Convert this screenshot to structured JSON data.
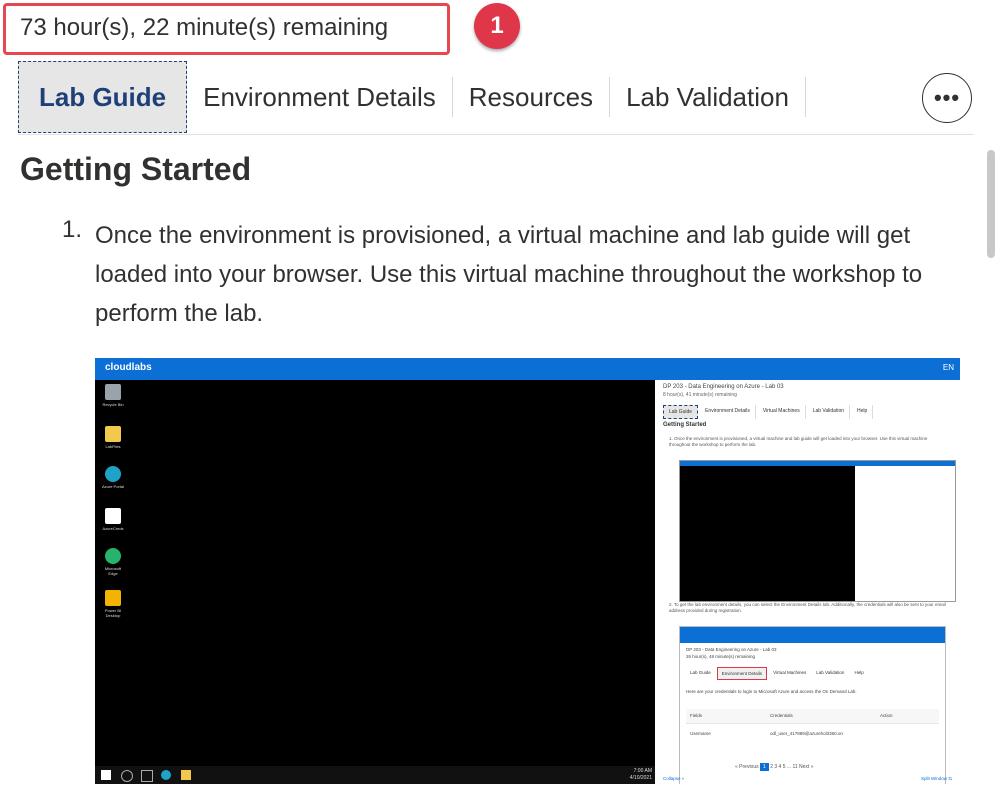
{
  "timer": {
    "text": "73 hour(s), 22 minute(s) remaining"
  },
  "annotation": {
    "badge": "1"
  },
  "tabs": [
    {
      "label": "Lab Guide"
    },
    {
      "label": "Environment Details"
    },
    {
      "label": "Resources"
    },
    {
      "label": "Lab Validation"
    }
  ],
  "more_button": {
    "label": "•••"
  },
  "content": {
    "heading": "Getting Started",
    "step1": {
      "number": "1.",
      "text": "Once the environment is provisioned, a virtual machine and lab guide will get loaded into your browser. Use this virtual machine throughout the workshop to perform the lab."
    }
  },
  "embedded": {
    "logo": "cloudlabs",
    "lang": "EN",
    "desktop_icons": [
      "Recycle Bin",
      "LabFiles",
      "Azure Portal",
      "AzureCreds",
      "Microsoft Edge",
      "Power BI Desktop"
    ],
    "clock": {
      "time": "7:00 AM",
      "date": "4/10/2021"
    },
    "side": {
      "title": "DP 203 - Data Engineering on Azure - Lab 03",
      "remaining": "8 hour(s), 41 minute(s) remaining",
      "tabs": [
        "Lab Guide",
        "Environment Details",
        "Virtual Machines",
        "Lab Validation",
        "Help"
      ],
      "heading": "Getting Started",
      "step1": "1. Once the environment is provisioned, a virtual machine and lab guide will get loaded into your browser. Use this virtual machine throughout the workshop to perform the lab.",
      "step2": "2. To get the lab environment details, you can select the Environment Details tab. Additionally, the credentials will also be sent to your email address provided during registration.",
      "mini_title": "DP 203 - Data Engineering on Azure - Lab 03",
      "mini_remaining": "26 hour(s), 48 minute(s) remaining",
      "mini_tabs": [
        "Lab Guide",
        "Environment Details",
        "Virtual Machines",
        "Lab Validation",
        "Help"
      ],
      "mini_text": "Here are your credentials to login to Microsoft Azure and access the On Demand Lab.",
      "table_headers": [
        "Fields",
        "Credentials",
        "Action"
      ],
      "table_row": [
        "Username",
        "odl_user_417889@azurehol3360.on"
      ],
      "pager": {
        "prev": "« Previous",
        "pages": [
          "1",
          "2",
          "3",
          "4",
          "5",
          "...",
          "11"
        ],
        "next": "Next »"
      },
      "collapse": "Collapse »",
      "split": "Split Window ⇆"
    }
  }
}
